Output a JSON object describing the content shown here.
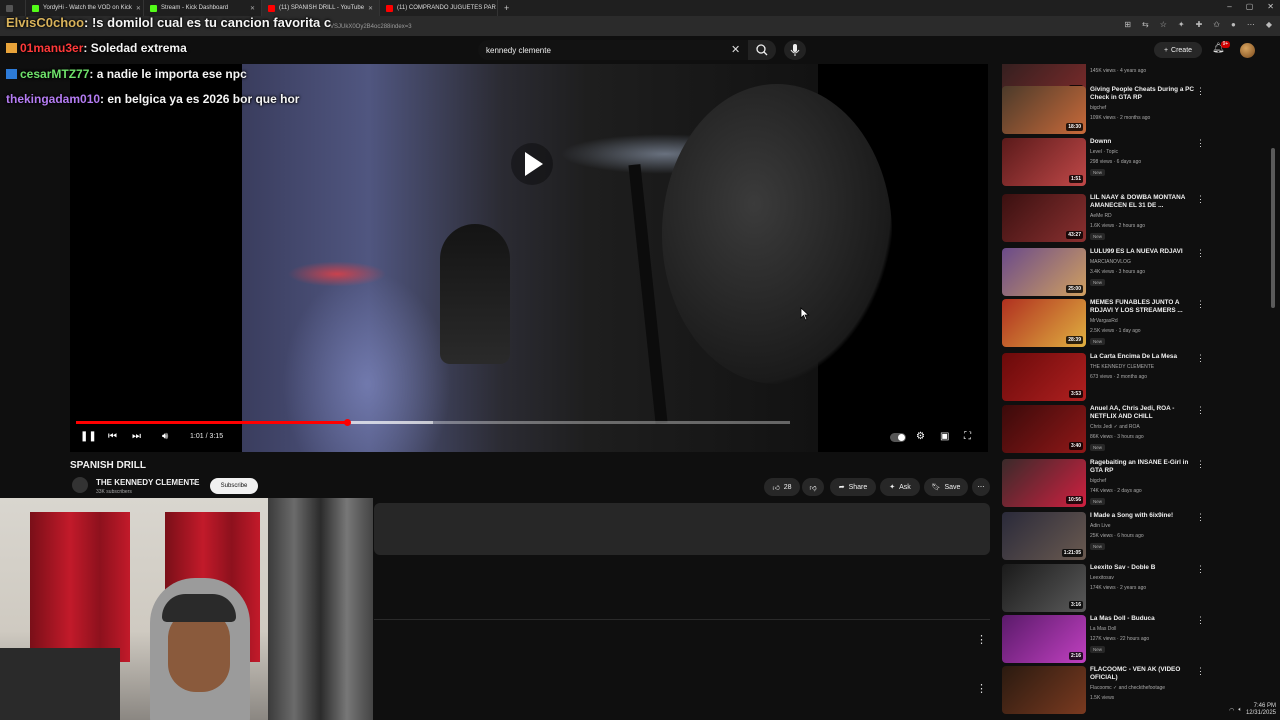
{
  "browser": {
    "tabs": [
      {
        "label": "YordyHi - Watch the VOD on Kick",
        "color": "#53fc18",
        "active": false
      },
      {
        "label": "Stream - Kick Dashboard",
        "color": "#53fc18",
        "active": false
      },
      {
        "label": "(11) SPANISH DRILL - YouTube",
        "color": "#ff0000",
        "active": true
      },
      {
        "label": "(11) COMPRANDO JUGUETES PAR",
        "color": "#ff0000",
        "active": false
      }
    ],
    "new_tab": "+",
    "url": "VSJUkX0Oy2B4oc288index=3"
  },
  "chat": [
    {
      "id": "chat-top",
      "user": "ElvisC0choo",
      "message": ": !s domilol cual es tu cancion favorita c"
    },
    {
      "id": "chat-sole",
      "user": "01manu3er",
      "message": ": Soledad extrema"
    },
    {
      "id": "chat-cesar",
      "user": "cesarMTZ77",
      "message": ": a nadie le importa ese npc"
    },
    {
      "id": "chat-thek",
      "user": "thekingadam010",
      "message": ": en belgica ya es 2026 bor que hor"
    }
  ],
  "header": {
    "search_value": "kennedy clemente",
    "create_label": "Create",
    "notif_count": "9+"
  },
  "player": {
    "time": "1:01 / 3:15",
    "progress": 0.38,
    "buffered": 0.5
  },
  "video": {
    "title": "SPANISH DRILL",
    "channel": "THE KENNEDY CLEMENTE",
    "subscribers": "33K subscribers",
    "subscribe_label": "Subscribe",
    "likes": "28",
    "share_label": "Share",
    "ask_label": "Ask",
    "save_label": "Save"
  },
  "sidebar": {
    "items": [
      {
        "title": "",
        "channel": "",
        "meta": "145K views · 4 years ago",
        "duration": "2:44",
        "new": false,
        "verified": false,
        "colors": [
          "#2b1e1e",
          "#7a2a2a"
        ]
      },
      {
        "title": "Giving People Cheats During a PC Check in GTA RP",
        "channel": "bigchef",
        "meta": "109K views · 2 months ago",
        "duration": "18:30",
        "new": false,
        "verified": true,
        "colors": [
          "#4b3a2a",
          "#c96a3a"
        ]
      },
      {
        "title": "Downn",
        "channel": "Level · Topic",
        "meta": "298 views · 6 days ago",
        "duration": "1:51",
        "new": true,
        "verified": false,
        "colors": [
          "#5a1a1a",
          "#c04848"
        ]
      },
      {
        "title": "LIL NAAY & DOWBA MONTANA AMANECEN EL 31 DE ...",
        "channel": "AeMe RD",
        "meta": "1.6K views · 2 hours ago",
        "duration": "43:27",
        "new": true,
        "verified": false,
        "colors": [
          "#3a1010",
          "#8a3030"
        ]
      },
      {
        "title": "LULU99 ES LA NUEVA RDJAVI",
        "channel": "MARCIANOVLOG",
        "meta": "3.4K views · 3 hours ago",
        "duration": "25:00",
        "new": true,
        "verified": true,
        "colors": [
          "#6a4a8a",
          "#d0a060"
        ]
      },
      {
        "title": "MEMES FUNABLES JUNTO A RDJAVI Y LOS STREAMERS ...",
        "channel": "MrVargasRd",
        "meta": "2.5K views · 1 day ago",
        "duration": "28:39",
        "new": true,
        "verified": false,
        "colors": [
          "#b03020",
          "#e0b040"
        ]
      },
      {
        "title": "La Carta Encima De La Mesa",
        "channel": "THE KENNEDY CLEMENTE",
        "meta": "673 views · 2 months ago",
        "duration": "3:53",
        "new": false,
        "verified": true,
        "colors": [
          "#6a0a0a",
          "#b02020"
        ]
      },
      {
        "title": "Anuel AA, Chris Jedi, ROA - NETFLIX AND CHILL",
        "channel": "Chris Jedi ✓ and ROA",
        "meta": "86K views · 3 hours ago",
        "duration": "3:40",
        "new": true,
        "verified": true,
        "colors": [
          "#3a0a0a",
          "#901818"
        ]
      },
      {
        "title": "Ragebaiting an INSANE E-Girl in GTA RP",
        "channel": "bigchef",
        "meta": "74K views · 2 days ago",
        "duration": "10:56",
        "new": true,
        "verified": true,
        "colors": [
          "#3a2a2a",
          "#d02040"
        ]
      },
      {
        "title": "I Made a Song with 6ix9ine!",
        "channel": "Adin Live",
        "meta": "25K views · 6 hours ago",
        "duration": "1:21:05",
        "new": true,
        "verified": true,
        "colors": [
          "#2a2a3a",
          "#6a5a50"
        ]
      },
      {
        "title": "Leexito Sav - Doble B",
        "channel": "Leexitosav",
        "meta": "174K views · 2 years ago",
        "duration": "3:16",
        "new": false,
        "verified": false,
        "colors": [
          "#1a1a1a",
          "#5a5a5a"
        ]
      },
      {
        "title": "La Mas Doll - Buduca",
        "channel": "La Mas Doll",
        "meta": "127K views · 22 hours ago",
        "duration": "2:16",
        "new": true,
        "verified": true,
        "colors": [
          "#5a1a6a",
          "#c040c0"
        ]
      },
      {
        "title": "FLACOOMC - VEN AK (VIDEO OFICIAL)",
        "channel": "Flacoomc ✓ and checkthefootage",
        "meta": "1.5K views",
        "duration": "",
        "new": false,
        "verified": true,
        "colors": [
          "#2a1a10",
          "#7a3a20"
        ]
      }
    ],
    "new_label": "New"
  },
  "taskbar": {
    "time": "7:46 PM",
    "date": "12/31/2025"
  }
}
